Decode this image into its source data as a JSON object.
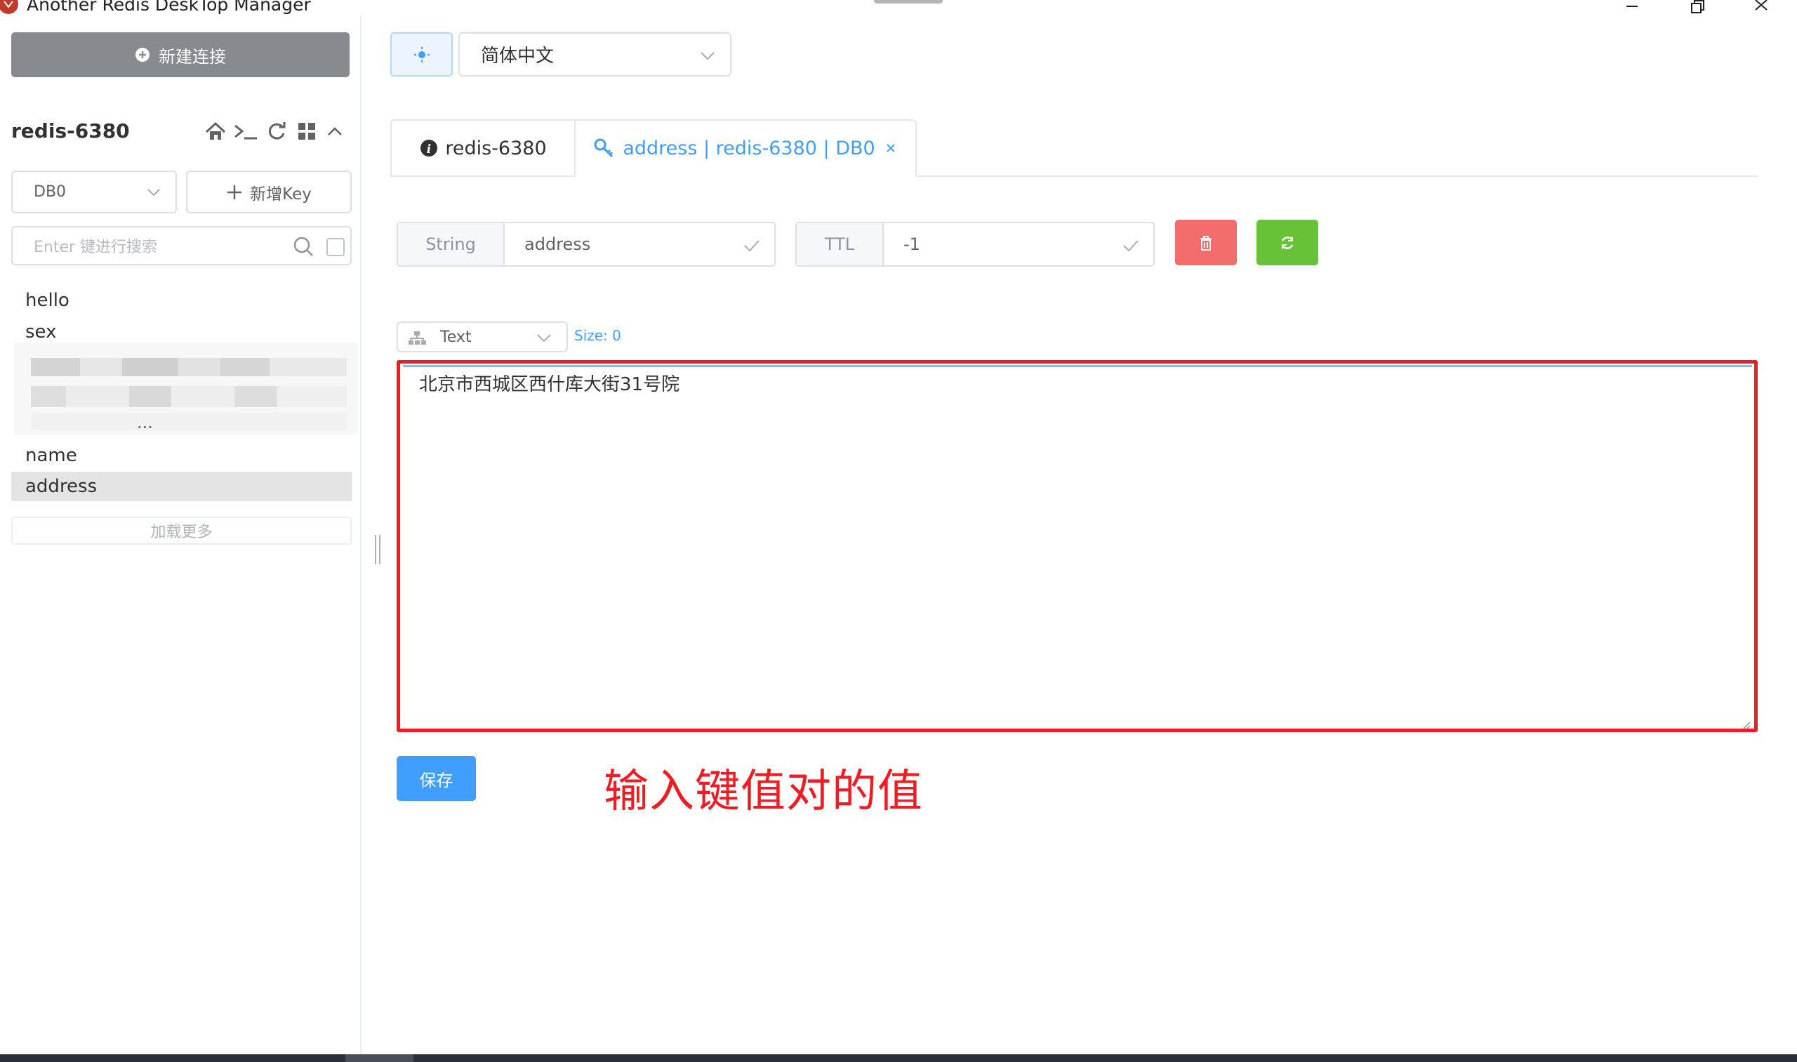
{
  "window": {
    "title": "Another Redis DeskTop Manager",
    "controls": [
      "minimize",
      "maximize",
      "close"
    ]
  },
  "sidebar": {
    "new_connection_label": "新建连接",
    "connection_name": "redis-6380",
    "toolbar_icons": [
      "home-icon",
      "terminal-icon",
      "refresh-icon",
      "grid-icon",
      "chevron-up-icon"
    ],
    "db_select": "DB0",
    "add_key_label": "新增Key",
    "search_placeholder": "Enter 键进行搜索",
    "keys": {
      "k0": "hello",
      "k1": "sex",
      "k2": "name",
      "k3": "address"
    },
    "selected_key": "address",
    "blurred_key_fragment": "...",
    "load_more_label": "加载更多"
  },
  "topbar": {
    "theme_icon": "sun-icon",
    "language": "简体中文"
  },
  "tabs": {
    "info_label": "redis-6380",
    "key_label": "address | redis-6380 | DB0"
  },
  "key_panel": {
    "type_label": "String",
    "key_name": "address",
    "ttl_label": "TTL",
    "ttl_value": "-1",
    "format": "Text",
    "size_label": "Size: 0",
    "value_text": "北京市西城区西什库大街31号院",
    "save_label": "保存"
  },
  "annotation": "输入键值对的值",
  "colors": {
    "primary": "#409eff",
    "danger": "#f56c6c",
    "success": "#67c23a",
    "new_connection_bg": "#878a8f",
    "highlight_red": "#ee1c24",
    "selected_row": "#e4e4e4"
  }
}
